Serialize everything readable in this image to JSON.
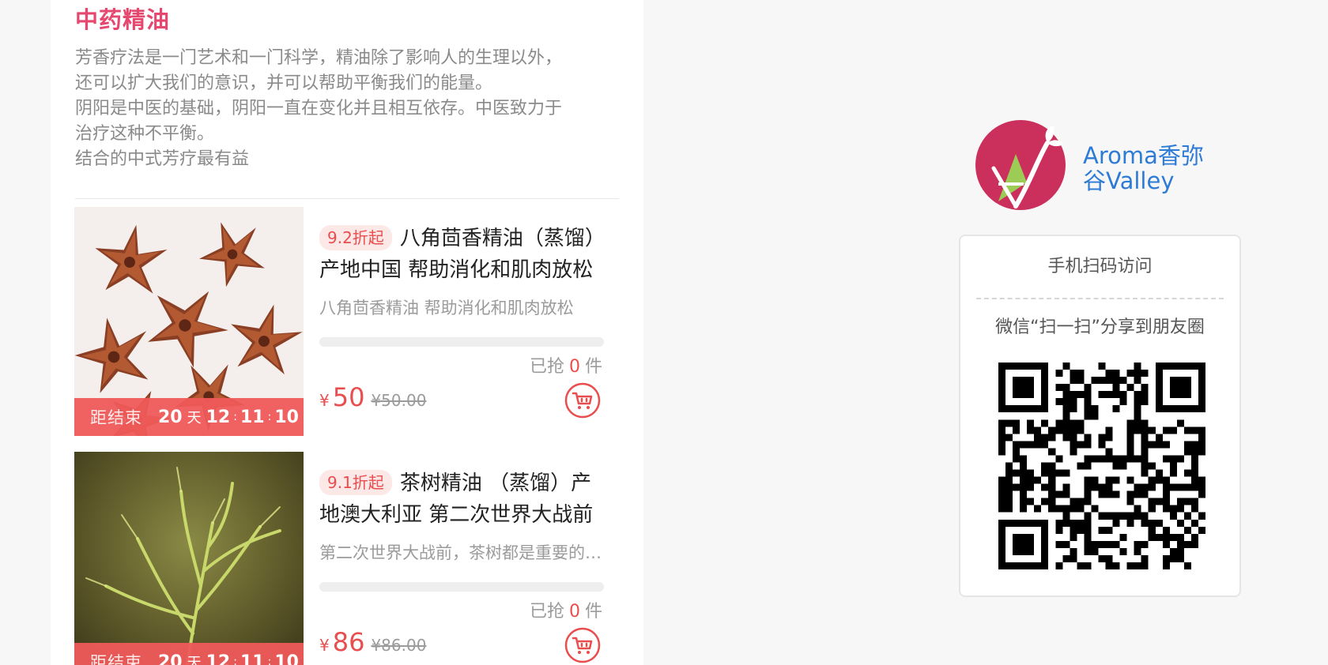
{
  "section": {
    "title": "中药精油",
    "description": [
      "芳香疗法是一门艺术和一门科学，精油除了影响人的生理以外，",
      "还可以扩大我们的意识，并可以帮助平衡我们的能量。",
      "阴阳是中医的基础，阴阳一直在变化并且相互依存。中医致力于",
      "治疗这种不平衡。",
      "结合的中式芳疗最有益"
    ]
  },
  "products": [
    {
      "discount": "9.2折起",
      "title": "八角茴香精油（蒸馏）产地中国 帮助消化和肌肉放松",
      "subtitle": "八角茴香精油 帮助消化和肌肉放松",
      "countdown": {
        "label": "距结束",
        "days": "20",
        "day_unit": "天",
        "hours": "12",
        "minutes": "11",
        "seconds": "10"
      },
      "progress": 0,
      "sold_prefix": "已抢",
      "sold_count": "0",
      "sold_suffix": "件",
      "currency": "¥",
      "price": "50",
      "original_price": "¥50.00",
      "image": "star-anise-photo"
    },
    {
      "discount": "9.1折起",
      "title": "茶树精油 （蒸馏）产地澳大利亚 第二次世界大战前",
      "subtitle": "第二次世界大战前，茶树都是重要的天然消毒剂",
      "countdown": {
        "label": "距结束",
        "days": "20",
        "day_unit": "天",
        "hours": "12",
        "minutes": "11",
        "seconds": "10"
      },
      "progress": 0,
      "sold_prefix": "已抢",
      "sold_count": "0",
      "sold_suffix": "件",
      "currency": "¥",
      "price": "86",
      "original_price": "¥86.00",
      "image": "tea-tree-photo"
    }
  ],
  "brand": {
    "name": "Aroma香弥谷Valley",
    "logo_colors": {
      "circle": "#cb2f5c",
      "leaf": "#9ccc55"
    }
  },
  "qr": {
    "title": "手机扫码访问",
    "share_text": "微信“扫一扫”分享到朋友圈",
    "icon": "qr-code-icon"
  },
  "colors": {
    "accent": "#e94d4d",
    "title_pink": "#e5476f",
    "link_blue": "#2e7bd6"
  }
}
